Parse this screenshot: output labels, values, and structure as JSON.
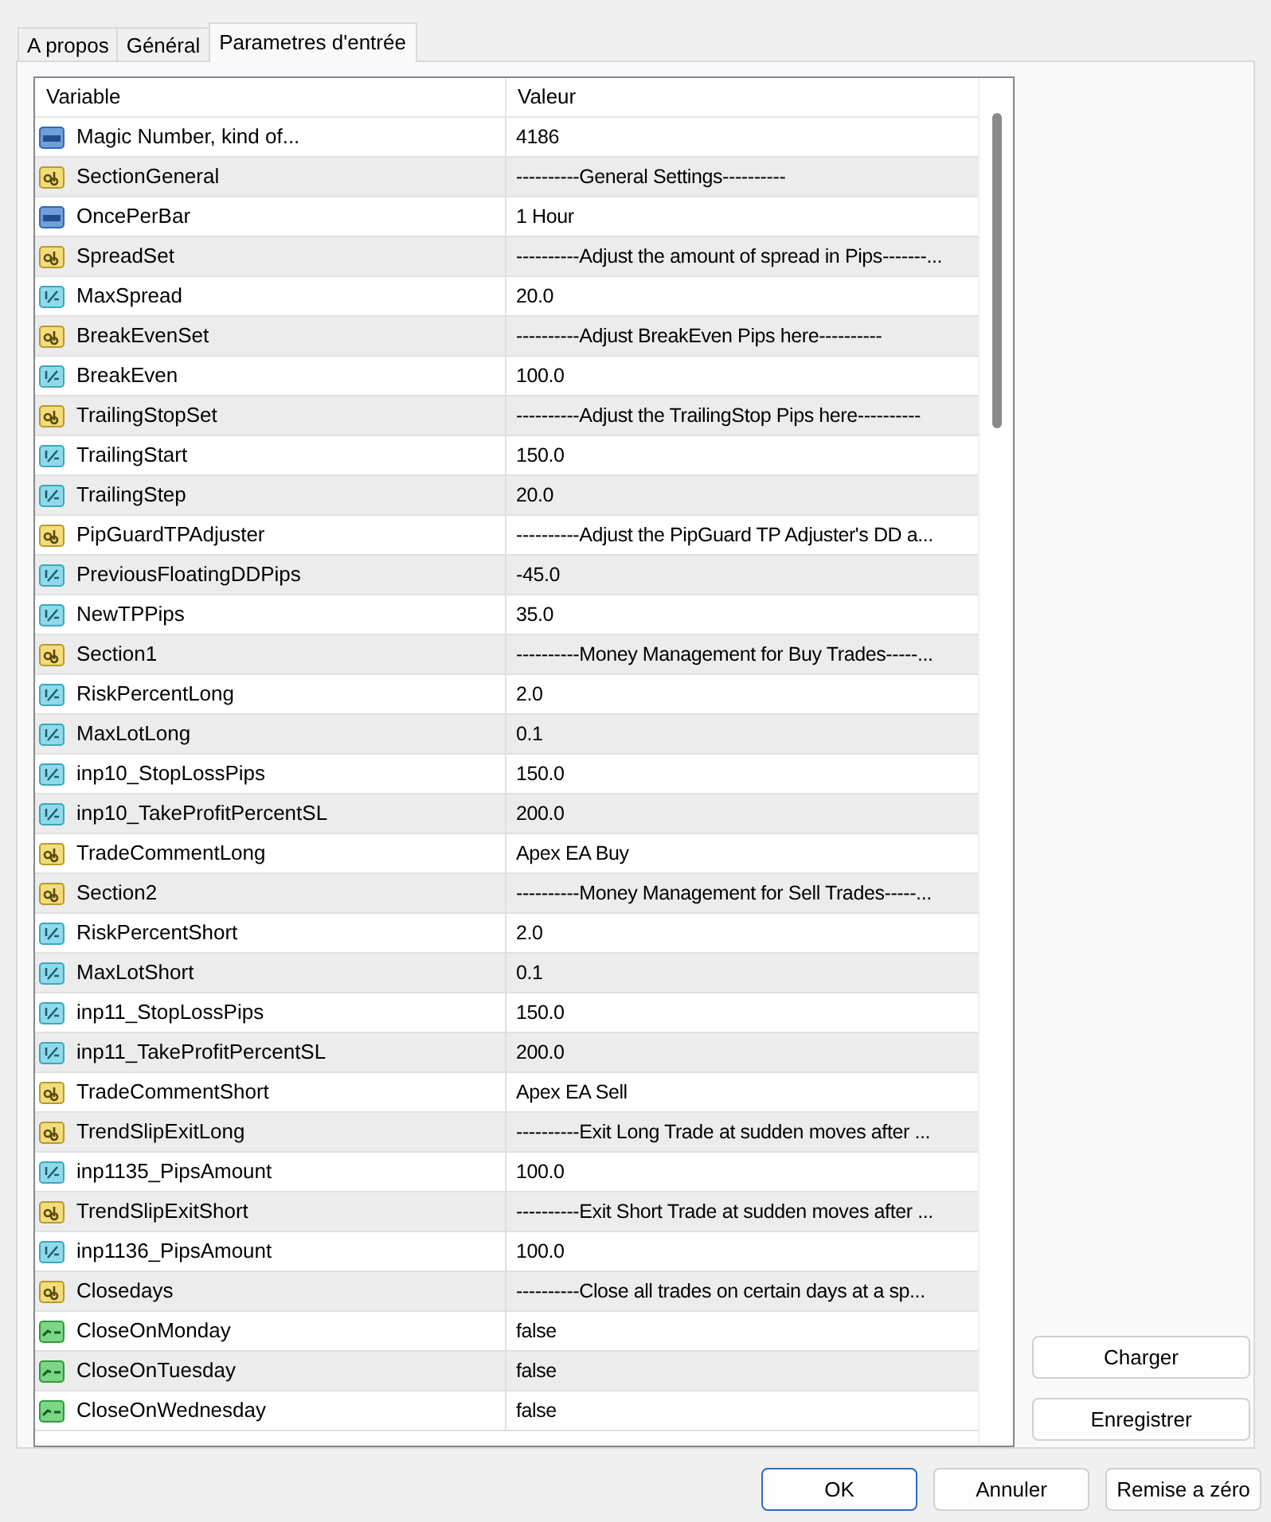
{
  "tabs": [
    {
      "label": "A propos",
      "selected": false
    },
    {
      "label": "Général",
      "selected": false
    },
    {
      "label": "Parametres d'entrée",
      "selected": true
    }
  ],
  "table": {
    "columns": [
      "Variable",
      "Valeur"
    ],
    "rows": [
      {
        "kind": "int",
        "variable": "Magic Number, kind of...",
        "value": "4186"
      },
      {
        "kind": "string",
        "variable": "SectionGeneral",
        "value": "----------General Settings----------"
      },
      {
        "kind": "int",
        "variable": "OncePerBar",
        "value": "1 Hour"
      },
      {
        "kind": "string",
        "variable": "SpreadSet",
        "value": "----------Adjust the amount of spread in Pips-------..."
      },
      {
        "kind": "double",
        "variable": "MaxSpread",
        "value": "20.0"
      },
      {
        "kind": "string",
        "variable": "BreakEvenSet",
        "value": "----------Adjust BreakEven Pips here----------"
      },
      {
        "kind": "double",
        "variable": "BreakEven",
        "value": "100.0"
      },
      {
        "kind": "string",
        "variable": "TrailingStopSet",
        "value": "----------Adjust the TrailingStop Pips here----------"
      },
      {
        "kind": "double",
        "variable": "TrailingStart",
        "value": "150.0"
      },
      {
        "kind": "double",
        "variable": "TrailingStep",
        "value": "20.0"
      },
      {
        "kind": "string",
        "variable": "PipGuardTPAdjuster",
        "value": "----------Adjust the PipGuard TP Adjuster's DD a..."
      },
      {
        "kind": "double",
        "variable": "PreviousFloatingDDPips",
        "value": "-45.0"
      },
      {
        "kind": "double",
        "variable": "NewTPPips",
        "value": "35.0"
      },
      {
        "kind": "string",
        "variable": "Section1",
        "value": "----------Money Management for Buy Trades-----..."
      },
      {
        "kind": "double",
        "variable": "RiskPercentLong",
        "value": "2.0"
      },
      {
        "kind": "double",
        "variable": "MaxLotLong",
        "value": "0.1"
      },
      {
        "kind": "double",
        "variable": "inp10_StopLossPips",
        "value": "150.0"
      },
      {
        "kind": "double",
        "variable": "inp10_TakeProfitPercentSL",
        "value": "200.0"
      },
      {
        "kind": "string",
        "variable": "TradeCommentLong",
        "value": "Apex EA Buy"
      },
      {
        "kind": "string",
        "variable": "Section2",
        "value": "----------Money Management for Sell Trades-----..."
      },
      {
        "kind": "double",
        "variable": "RiskPercentShort",
        "value": "2.0"
      },
      {
        "kind": "double",
        "variable": "MaxLotShort",
        "value": "0.1"
      },
      {
        "kind": "double",
        "variable": "inp11_StopLossPips",
        "value": "150.0"
      },
      {
        "kind": "double",
        "variable": "inp11_TakeProfitPercentSL",
        "value": "200.0"
      },
      {
        "kind": "string",
        "variable": "TradeCommentShort",
        "value": "Apex EA Sell"
      },
      {
        "kind": "string",
        "variable": "TrendSlipExitLong",
        "value": "----------Exit Long Trade at sudden moves after ..."
      },
      {
        "kind": "double",
        "variable": "inp1135_PipsAmount",
        "value": "100.0"
      },
      {
        "kind": "string",
        "variable": "TrendSlipExitShort",
        "value": "----------Exit Short Trade at sudden moves after ..."
      },
      {
        "kind": "double",
        "variable": "inp1136_PipsAmount",
        "value": "100.0"
      },
      {
        "kind": "string",
        "variable": "Closedays",
        "value": "----------Close all trades on certain days at a sp..."
      },
      {
        "kind": "bool",
        "variable": "CloseOnMonday",
        "value": "false"
      },
      {
        "kind": "bool",
        "variable": "CloseOnTuesday",
        "value": "false"
      },
      {
        "kind": "bool",
        "variable": "CloseOnWednesday",
        "value": "false"
      }
    ]
  },
  "side_buttons": [
    "Charger",
    "Enregistrer"
  ],
  "buttons": [
    {
      "label": "OK",
      "default": true
    },
    {
      "label": "Annuler",
      "default": false
    },
    {
      "label": "Remise a zéro",
      "default": false
    }
  ]
}
